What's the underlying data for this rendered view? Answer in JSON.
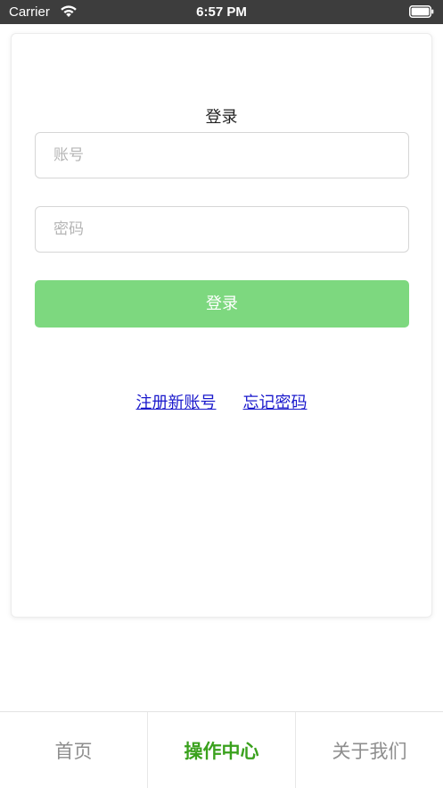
{
  "status_bar": {
    "carrier": "Carrier",
    "time": "6:57 PM",
    "wifi_icon": "wifi-icon",
    "battery_icon": "battery-full-icon"
  },
  "login": {
    "title": "登录",
    "account_placeholder": "账号",
    "password_placeholder": "密码",
    "account_value": "",
    "password_value": "",
    "button_label": "登录",
    "button_color": "#7dd87f",
    "register_link": "注册新账号",
    "forgot_link": "忘记密码",
    "link_color": "#1a19cc"
  },
  "tabs": [
    {
      "label": "首页",
      "active": false
    },
    {
      "label": "操作中心",
      "active": true
    },
    {
      "label": "关于我们",
      "active": false
    }
  ],
  "colors": {
    "status_bar_bg": "#3d3d3d",
    "active_tab": "#3aa11d",
    "inactive_tab": "#8e8e8e"
  }
}
